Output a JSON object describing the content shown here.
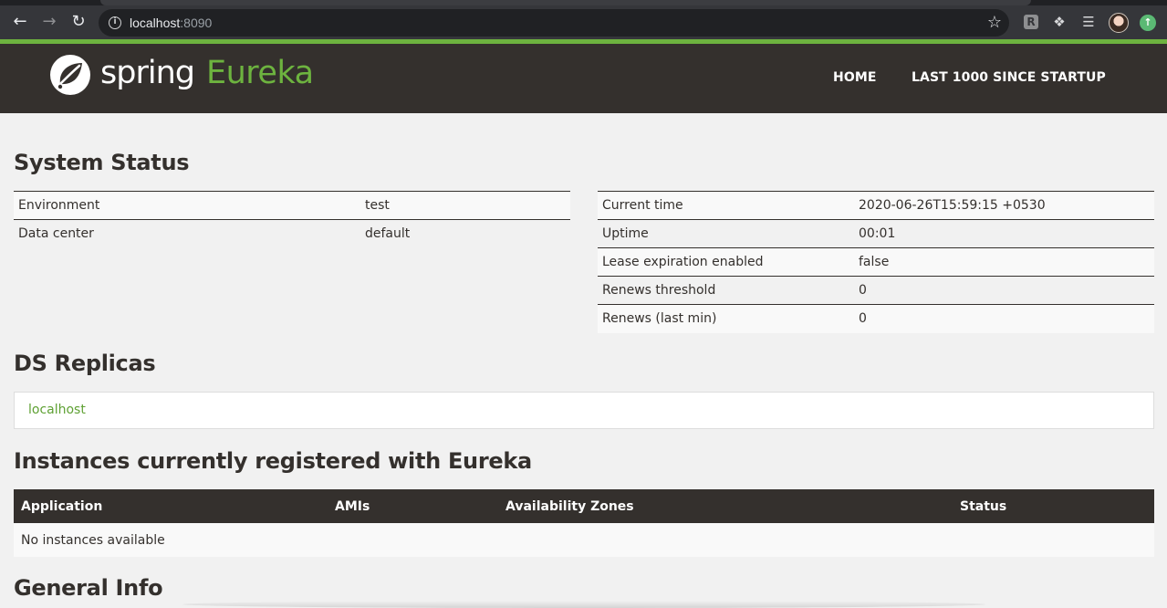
{
  "browser": {
    "url_host": "localhost",
    "url_port": ":8090",
    "icons": [
      "back-arrow-icon",
      "forward-arrow-icon",
      "reload-icon",
      "info-icon",
      "star-icon",
      "extension-r-icon",
      "puzzle-icon",
      "media-queue-icon",
      "avatar",
      "update-icon"
    ]
  },
  "header": {
    "brand_spring": "spring",
    "brand_eureka": "Eureka",
    "nav": {
      "home": "HOME",
      "last1000": "LAST 1000 SINCE STARTUP"
    },
    "colors": {
      "bg": "#34302d",
      "accent": "#6db33f"
    }
  },
  "system_status": {
    "title": "System Status",
    "left": [
      {
        "label": "Environment",
        "value": "test"
      },
      {
        "label": "Data center",
        "value": "default"
      }
    ],
    "right": [
      {
        "label": "Current time",
        "value": "2020-06-26T15:59:15 +0530"
      },
      {
        "label": "Uptime",
        "value": "00:01"
      },
      {
        "label": "Lease expiration enabled",
        "value": "false"
      },
      {
        "label": "Renews threshold",
        "value": "0"
      },
      {
        "label": "Renews (last min)",
        "value": "0"
      }
    ]
  },
  "ds_replicas": {
    "title": "DS Replicas",
    "items": [
      "localhost"
    ]
  },
  "instances": {
    "title": "Instances currently registered with Eureka",
    "columns": [
      "Application",
      "AMIs",
      "Availability Zones",
      "Status"
    ],
    "empty_message": "No instances available"
  },
  "general_info": {
    "title": "General Info"
  }
}
